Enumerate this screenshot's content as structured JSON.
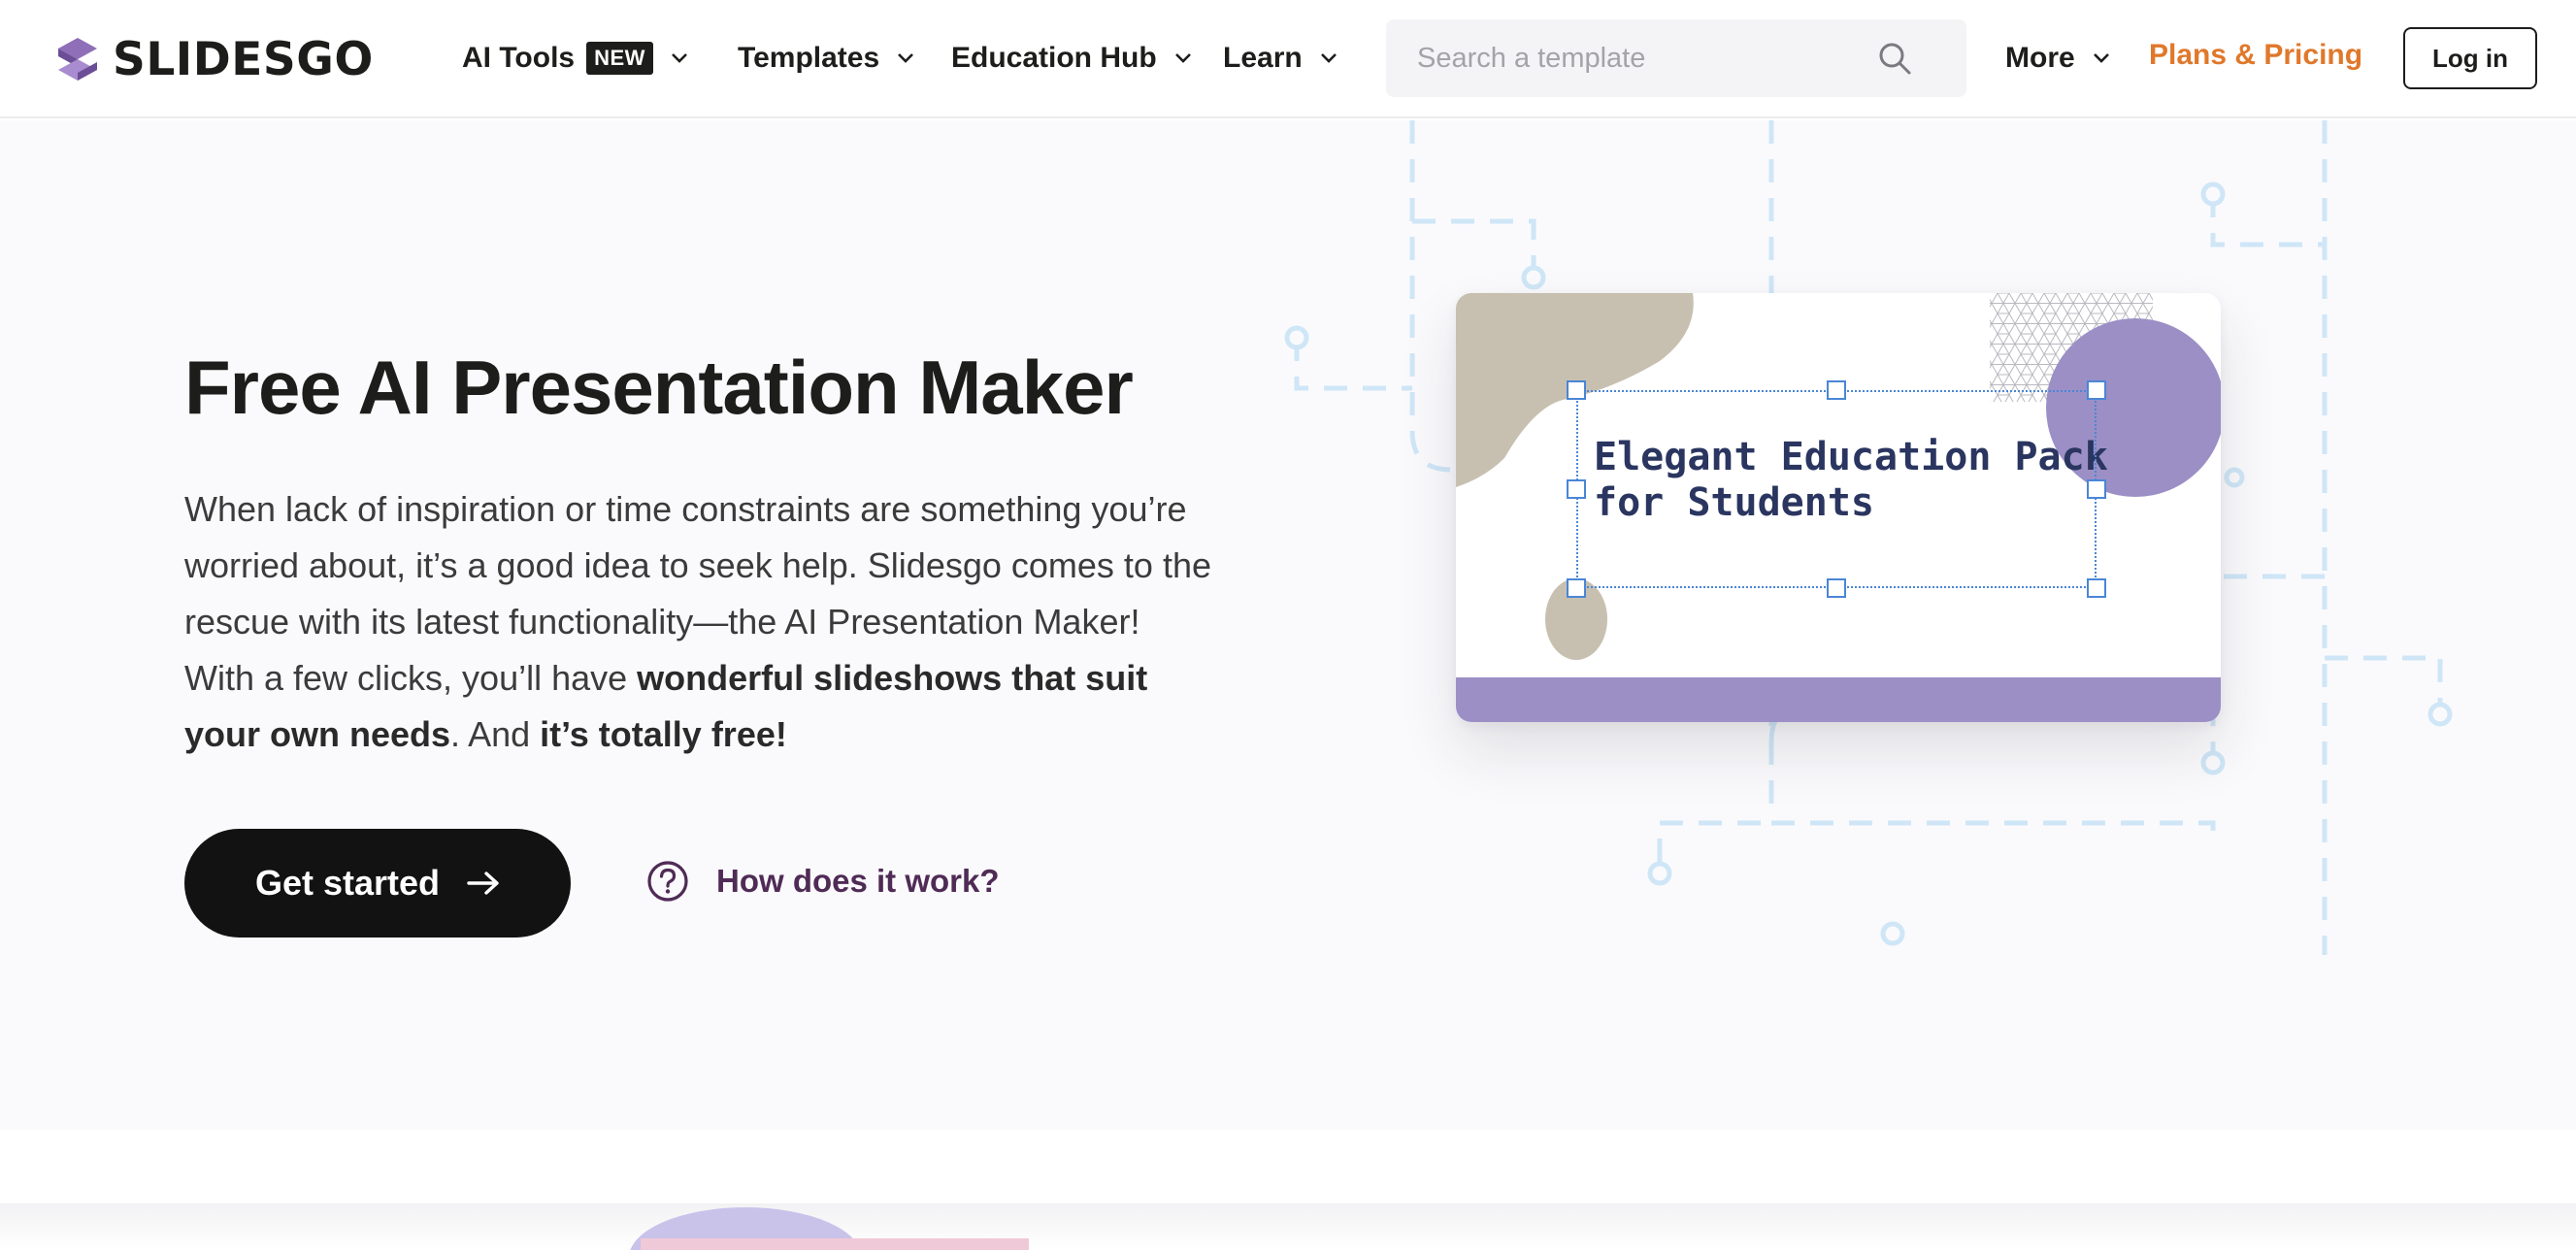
{
  "brand": {
    "name": "SLIDESGO"
  },
  "nav": {
    "items": [
      {
        "label": "AI Tools",
        "badge": "NEW"
      },
      {
        "label": "Templates"
      },
      {
        "label": "Education Hub"
      },
      {
        "label": "Learn"
      }
    ],
    "search_placeholder": "Search a template",
    "more_label": "More",
    "pricing_label": "Plans & Pricing",
    "login_label": "Log in"
  },
  "hero": {
    "title": "Free AI Presentation Maker",
    "desc_1": "When lack of inspiration or time constraints are something you’re worried about, it’s a good idea to seek help. Slidesgo comes to the rescue with its latest functionality—the AI Presentation Maker! With a few clicks, you’ll have ",
    "desc_bold_1": "wonderful slideshows that suit your own needs",
    "desc_2": ". And ",
    "desc_bold_2": "it’s totally free!",
    "cta_label": "Get started",
    "how_label": "How does it work?"
  },
  "slide_preview": {
    "title": "Elegant Education Pack\nfor Students"
  },
  "colors": {
    "accent_orange": "#e0782b",
    "how_purple": "#4f2b56",
    "slide_purple": "#9b8fc6",
    "slide_beige": "#c7c0b0",
    "circuit_blue": "#cfe6f7"
  }
}
